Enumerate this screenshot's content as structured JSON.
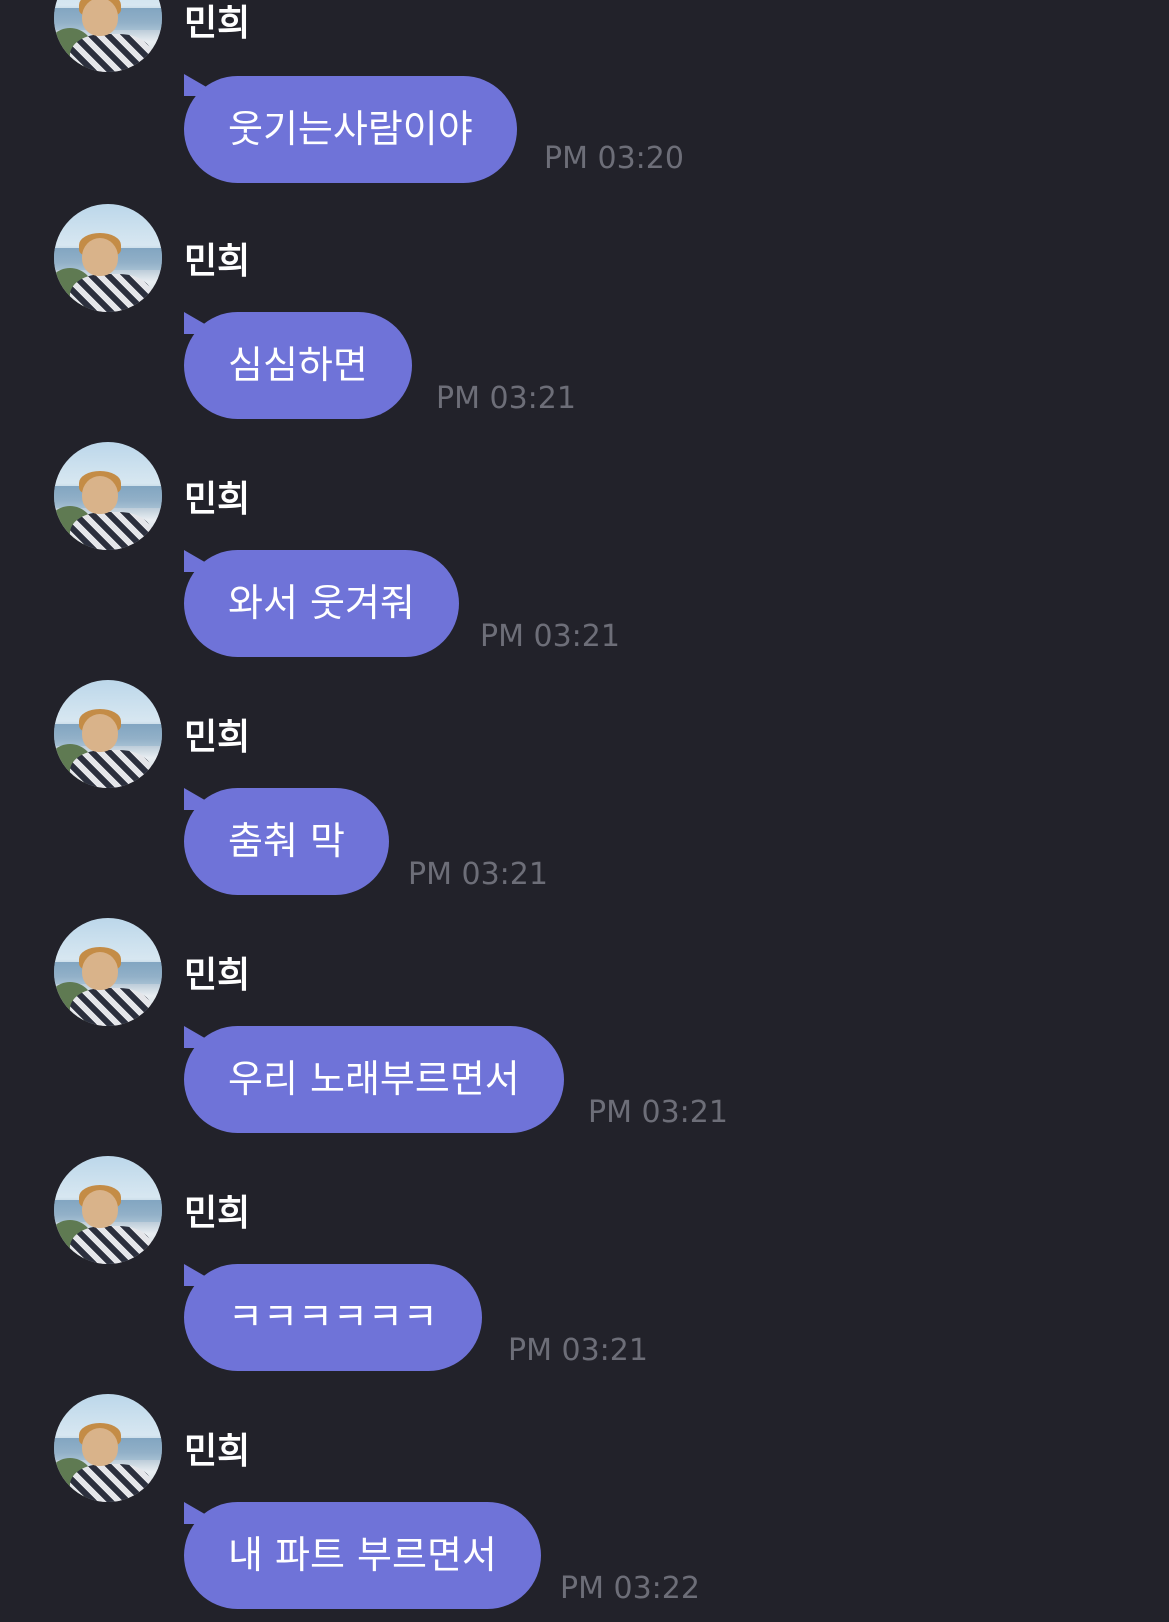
{
  "messages": [
    {
      "sender": "민희",
      "text": "웃기는사람이야",
      "time": "PM 03:20"
    },
    {
      "sender": "민희",
      "text": "심심하면",
      "time": "PM 03:21"
    },
    {
      "sender": "민희",
      "text": "와서 웃겨줘",
      "time": "PM 03:21"
    },
    {
      "sender": "민희",
      "text": "춤춰 막",
      "time": "PM 03:21"
    },
    {
      "sender": "민희",
      "text": "우리 노래부르면서",
      "time": "PM 03:21"
    },
    {
      "sender": "민희",
      "text": "ㅋㅋㅋㅋㅋㅋ",
      "time": "PM 03:21"
    },
    {
      "sender": "민희",
      "text": "내 파트 부르면서",
      "time": "PM 03:22"
    }
  ],
  "colors": {
    "background": "#22222a",
    "bubble": "#6f73d8",
    "time": "#6d6e78"
  }
}
